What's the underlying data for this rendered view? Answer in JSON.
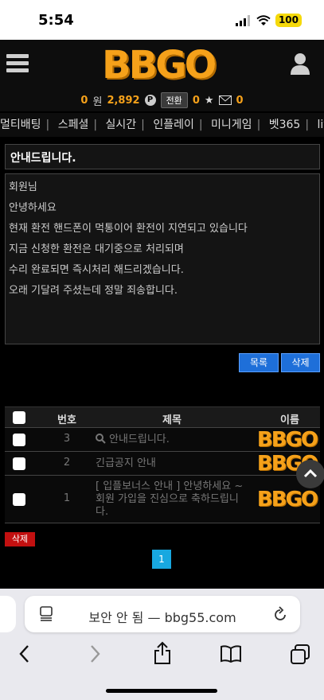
{
  "status": {
    "time": "5:54",
    "battery": "100"
  },
  "header": {
    "logo": "BBGO",
    "money": "0",
    "money_unit": "원",
    "points": "2,892",
    "point_badge": "P",
    "convert_label": "전환",
    "stars": "0",
    "messages": "0"
  },
  "nav": {
    "items": [
      "멀티배팅",
      "스페셜",
      "실시간",
      "인플레이",
      "미니게임",
      "벳365",
      "live카"
    ]
  },
  "notice": {
    "title": "안내드립니다.",
    "lines": [
      "회원님",
      "안녕하세요",
      "현재 환전 핸드폰이 먹통이어 환전이 지연되고 있습니다",
      "지금 신청한 환전은 대기중으로 처리되며",
      "수리 완료되면 즉시처리 해드리겠습니다.",
      "오래 기달려 주셨는데 정말 죄송합니다."
    ],
    "list_button": "목록",
    "delete_button": "삭제"
  },
  "table": {
    "headers": {
      "num": "번호",
      "title": "제목",
      "name": "이름"
    },
    "rows": [
      {
        "num": "3",
        "title": "안내드립니다.",
        "name": "BBGO"
      },
      {
        "num": "2",
        "title": "긴급공지 안내",
        "name": "BBGO"
      },
      {
        "num": "1",
        "title": "[ 입플보너스 안내 ] 안녕하세요 ~ 회원 가입을 진심으로 축하드립니다.",
        "name": "BBGO"
      }
    ],
    "delete_label": "삭제",
    "page": "1"
  },
  "browser": {
    "url_text": "보안 안 됨 — bbg55.com"
  }
}
